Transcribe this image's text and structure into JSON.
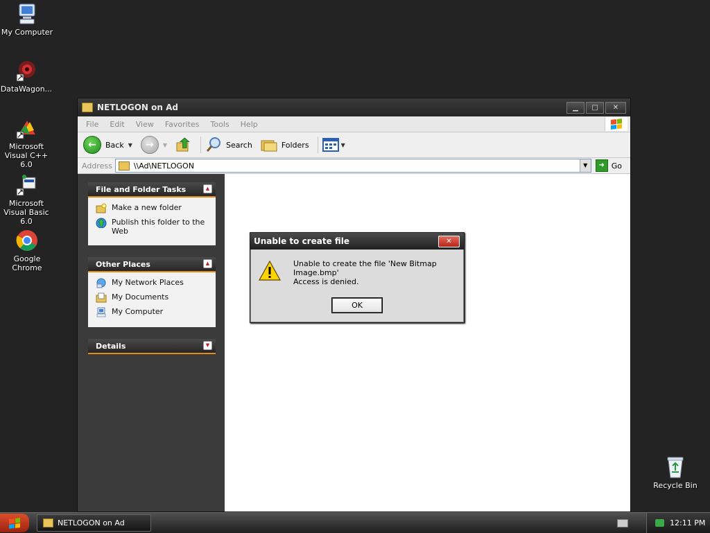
{
  "desktop": {
    "icons": [
      {
        "label": "My Computer"
      },
      {
        "label": "DataWagon..."
      },
      {
        "label": "Microsoft Visual C++ 6.0"
      },
      {
        "label": "Microsoft Visual Basic 6.0"
      },
      {
        "label": "Google Chrome"
      },
      {
        "label": "Recycle Bin"
      }
    ]
  },
  "window": {
    "title": "NETLOGON on Ad",
    "buttons": {
      "minimize": "▁",
      "maximize": "□",
      "close": "✕"
    },
    "menu": [
      "File",
      "Edit",
      "View",
      "Favorites",
      "Tools",
      "Help"
    ],
    "toolbar": {
      "back_label": "Back",
      "search_label": "Search",
      "folders_label": "Folders"
    },
    "address": {
      "label": "Address",
      "value": "\\\\Ad\\NETLOGON",
      "go_label": "Go"
    },
    "taskpane": {
      "file_tasks": {
        "title": "File and Folder Tasks",
        "items": [
          {
            "label": "Make a new folder",
            "icon": "new-folder-icon"
          },
          {
            "label": "Publish this folder to the Web",
            "icon": "publish-web-icon"
          }
        ]
      },
      "other_places": {
        "title": "Other Places",
        "items": [
          {
            "label": "My Network Places",
            "icon": "network-places-icon"
          },
          {
            "label": "My Documents",
            "icon": "my-documents-icon"
          },
          {
            "label": "My Computer",
            "icon": "my-computer-icon"
          }
        ]
      },
      "details": {
        "title": "Details"
      }
    }
  },
  "dialog": {
    "title": "Unable to create file",
    "message": "Unable to create the file 'New Bitmap Image.bmp'",
    "detail": "Access is denied.",
    "ok_label": "OK",
    "close_symbol": "✕"
  },
  "taskbar": {
    "task_label": "NETLOGON on Ad",
    "clock": "12:11 PM"
  },
  "colors": {
    "desktop": "#232323",
    "accent_orange": "#e38d12",
    "start_red": "#c0391d"
  }
}
